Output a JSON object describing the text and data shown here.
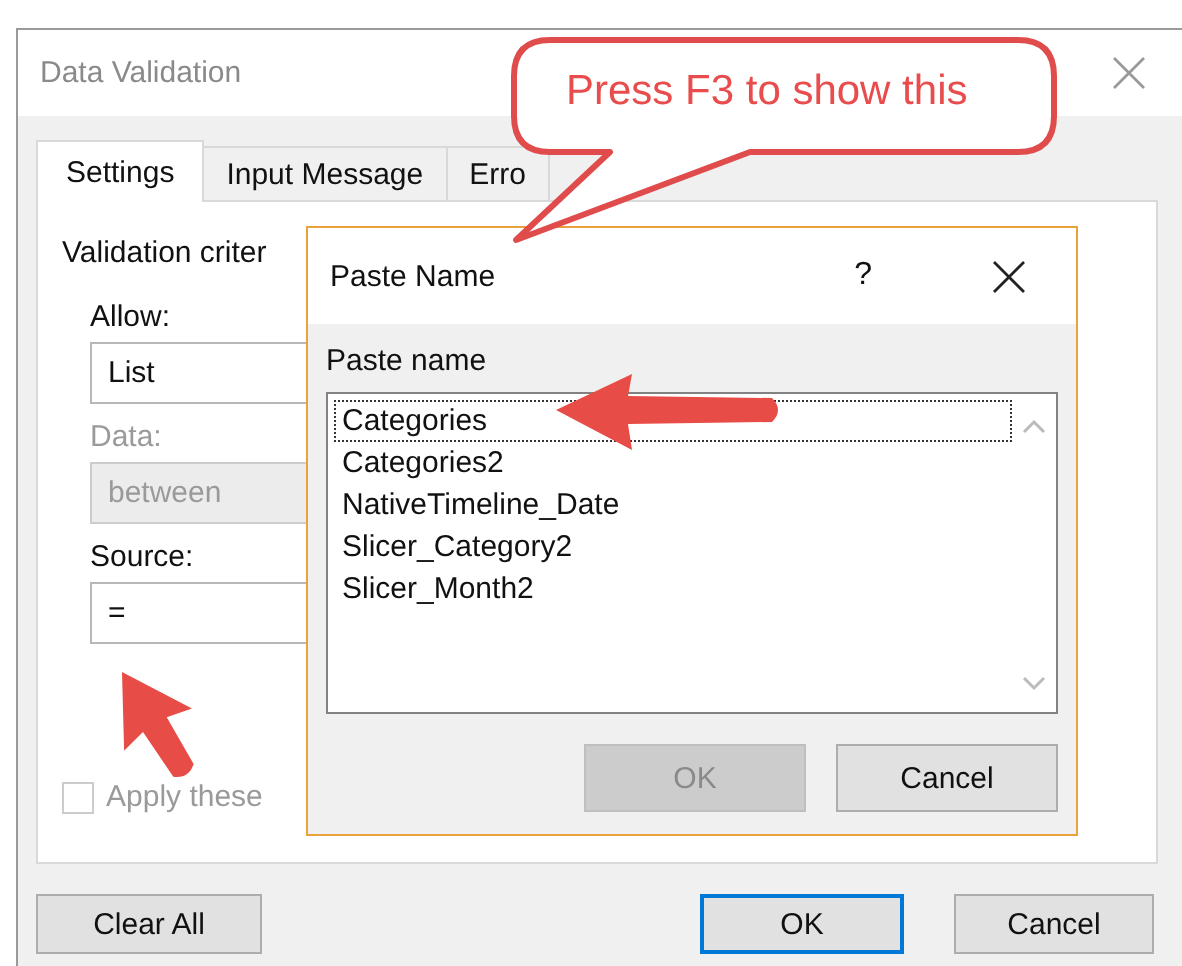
{
  "window": {
    "title": "Data Validation"
  },
  "tabs": [
    {
      "label": "Settings",
      "selected": true
    },
    {
      "label": "Input Message",
      "selected": false
    },
    {
      "label": "Erro",
      "selected": false
    }
  ],
  "settings": {
    "group_label": "Validation criter",
    "fields": [
      {
        "label": "Allow:",
        "value": "List",
        "disabled": false
      },
      {
        "label": "Data:",
        "value": "between",
        "disabled": true
      },
      {
        "label": "Source:",
        "value": "=",
        "disabled": false
      }
    ],
    "apply_checkbox": {
      "label": "Apply these",
      "checked": false,
      "disabled": true
    }
  },
  "buttons": [
    {
      "label": "Clear All",
      "default": false
    },
    {
      "label": "OK",
      "default": true
    },
    {
      "label": "Cancel",
      "default": false
    }
  ],
  "paste_name_dialog": {
    "title": "Paste Name",
    "help": "?",
    "list_label": "Paste name",
    "items": [
      {
        "name": "Categories",
        "focused": true
      },
      {
        "name": "Categories2",
        "focused": false
      },
      {
        "name": "NativeTimeline_Date",
        "focused": false
      },
      {
        "name": "Slicer_Category2",
        "focused": false
      },
      {
        "name": "Slicer_Month2",
        "focused": false
      }
    ],
    "buttons": [
      {
        "label": "OK",
        "disabled": true
      },
      {
        "label": "Cancel",
        "disabled": false
      }
    ]
  },
  "callout": {
    "text": "Press F3 to show this"
  }
}
